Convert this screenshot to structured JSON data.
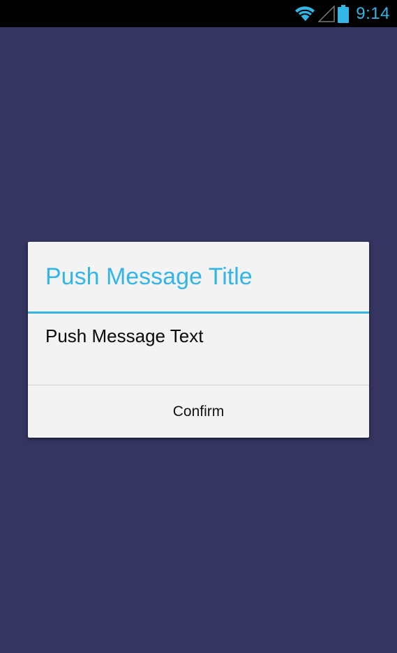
{
  "status_bar": {
    "time": "9:14",
    "icons": [
      "wifi-icon",
      "signal-icon",
      "battery-icon"
    ],
    "accent_color": "#33b5e5"
  },
  "background_color": "#363562",
  "dialog": {
    "title": "Push Message Title",
    "message": "Push Message Text",
    "confirm_label": "Confirm",
    "title_color": "#33b5e5",
    "background_color": "#f3f3f3"
  }
}
